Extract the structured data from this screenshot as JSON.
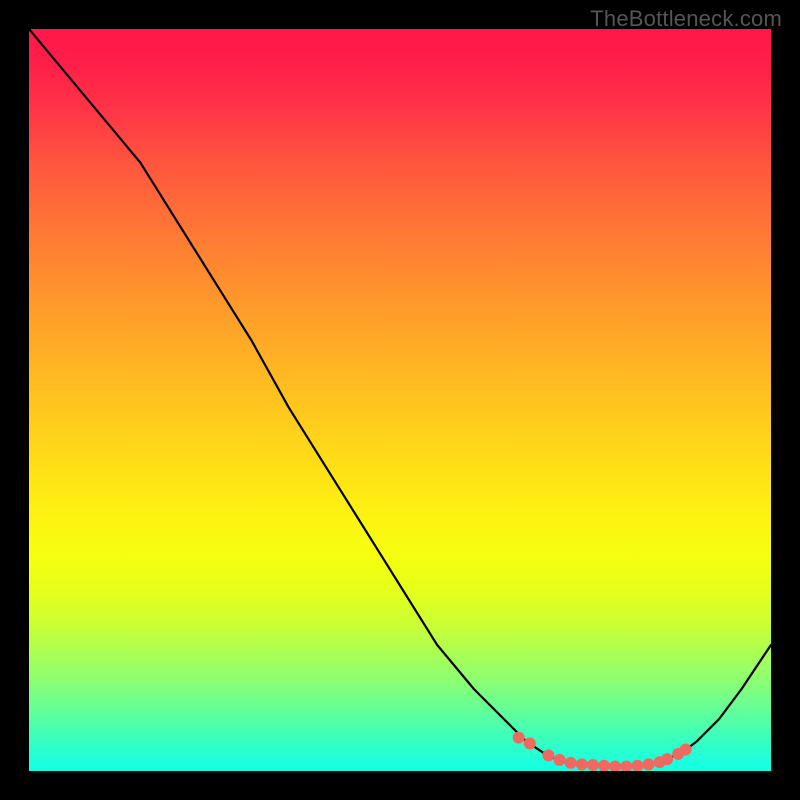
{
  "watermark": "TheBottleneck.com",
  "chart_data": {
    "type": "line",
    "title": "",
    "xlabel": "",
    "ylabel": "",
    "xlim": [
      0,
      100
    ],
    "ylim": [
      0,
      100
    ],
    "grid": false,
    "legend": false,
    "background_gradient": {
      "top": "#ff1749",
      "middle": "#ffdc18",
      "bottom": "#15ffe6"
    },
    "series": [
      {
        "name": "bottleneck-curve",
        "color": "#000000",
        "x": [
          0,
          5,
          10,
          15,
          20,
          25,
          30,
          35,
          40,
          45,
          50,
          55,
          60,
          65,
          67,
          70,
          72,
          75,
          78,
          80,
          82,
          85,
          88,
          90,
          93,
          96,
          100
        ],
        "y": [
          100,
          94,
          88,
          82,
          74,
          66,
          58,
          49,
          41,
          33,
          25,
          17,
          11,
          6,
          4,
          2,
          1.3,
          0.8,
          0.5,
          0.5,
          0.6,
          1.2,
          2.5,
          4,
          7,
          11,
          17
        ]
      }
    ],
    "dots": {
      "name": "data-points",
      "color": "#ef6960",
      "x": [
        66,
        67.5,
        70,
        71.5,
        73,
        74.5,
        76,
        77.5,
        79,
        80.5,
        82,
        83.5,
        85,
        86,
        87.5,
        88.5
      ],
      "y": [
        4.5,
        3.7,
        2.1,
        1.5,
        1.1,
        0.9,
        0.8,
        0.7,
        0.6,
        0.6,
        0.7,
        0.9,
        1.2,
        1.6,
        2.3,
        2.9
      ]
    }
  }
}
